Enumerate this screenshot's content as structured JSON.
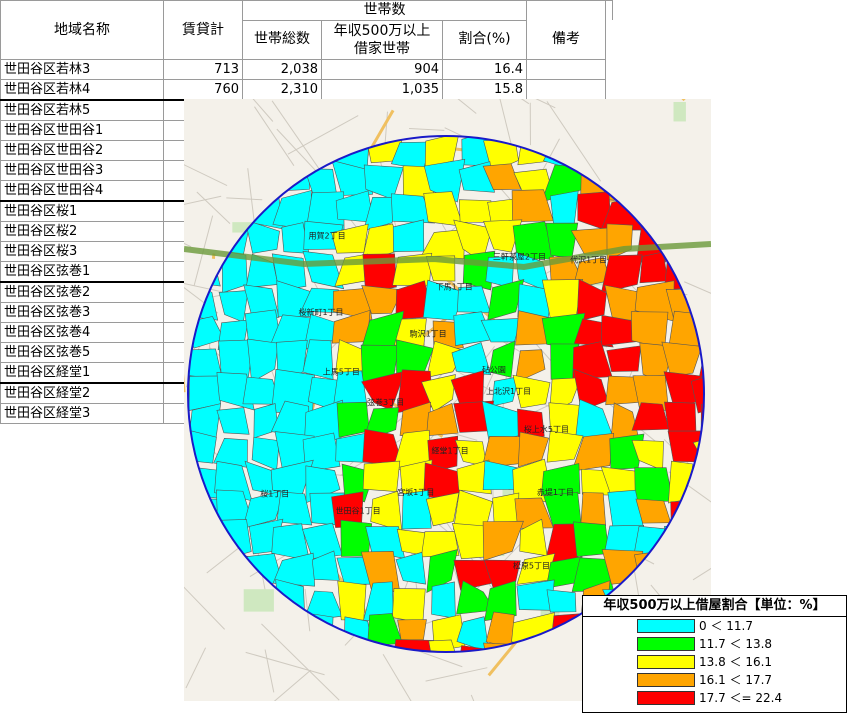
{
  "table": {
    "headers": {
      "region": "地域名称",
      "rental": "賃貸計",
      "group": "世帯数",
      "total": "世帯総数",
      "rent500_line1": "年収500万以上",
      "rent500_line2": "借家世帯",
      "ratio": "割合(%)",
      "notes": "備考"
    },
    "rows": [
      {
        "name": "世田谷区若林3",
        "rental": "713",
        "total": "2,038",
        "rent500": "904",
        "ratio": "16.4"
      },
      {
        "name": "世田谷区若林4",
        "rental": "760",
        "total": "2,310",
        "rent500": "1,035",
        "ratio": "15.8"
      },
      {
        "name": "世田谷区若林5"
      },
      {
        "name": "世田谷区世田谷1"
      },
      {
        "name": "世田谷区世田谷2"
      },
      {
        "name": "世田谷区世田谷3"
      },
      {
        "name": "世田谷区世田谷4"
      },
      {
        "name": "世田谷区桜1"
      },
      {
        "name": "世田谷区桜2"
      },
      {
        "name": "世田谷区桜3"
      },
      {
        "name": "世田谷区弦巻1"
      },
      {
        "name": "世田谷区弦巻2"
      },
      {
        "name": "世田谷区弦巻3"
      },
      {
        "name": "世田谷区弦巻4"
      },
      {
        "name": "世田谷区弦巻5"
      },
      {
        "name": "世田谷区経堂1"
      },
      {
        "name": "世田谷区経堂2"
      },
      {
        "name": "世田谷区経堂3"
      }
    ]
  },
  "map": {
    "circle_color": "#1a1ac8",
    "labels": [
      "上北沢1丁目",
      "桜上水5丁目",
      "赤堤1丁目",
      "松原5丁目",
      "経堂1丁目",
      "宮坂1丁目",
      "世田谷1丁目",
      "桜1丁目",
      "弦巻3丁目",
      "上馬5丁目",
      "桜新町1丁目",
      "用賀2丁目",
      "駒沢1丁目",
      "下馬1丁目",
      "三軒茶屋2丁目",
      "代沢1丁目",
      "砧公園"
    ]
  },
  "legend": {
    "title": "年収500万以上借屋割合【単位：%】",
    "items": [
      {
        "color": "#00ffff",
        "label": "0 ＜ 11.7"
      },
      {
        "color": "#00ff00",
        "label": "11.7 ＜ 13.8"
      },
      {
        "color": "#ffff00",
        "label": "13.8 ＜ 16.1"
      },
      {
        "color": "#ffa500",
        "label": "16.1 ＜ 17.7"
      },
      {
        "color": "#ff0000",
        "label": "17.7 ＜= 22.4"
      }
    ]
  }
}
